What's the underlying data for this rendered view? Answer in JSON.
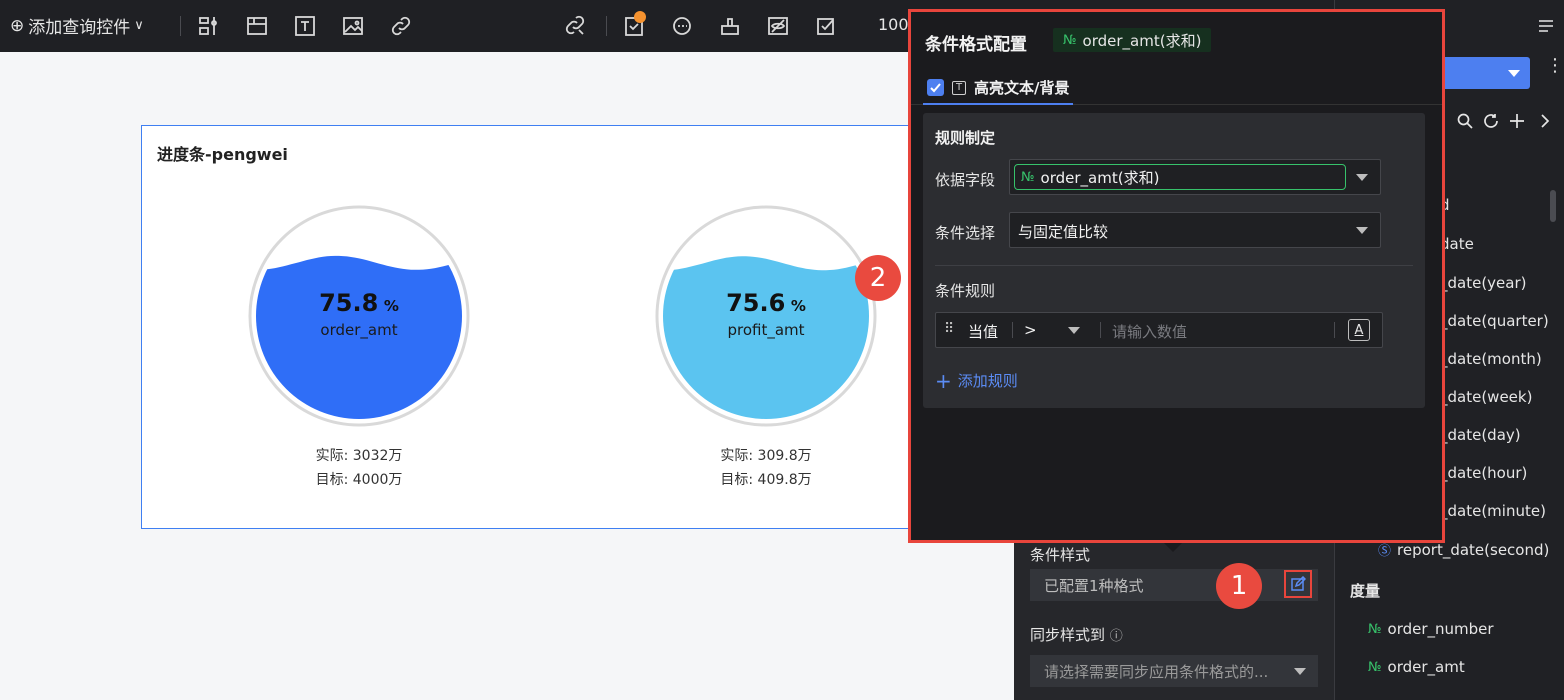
{
  "toolbar": {
    "add_query_label": "添加查询控件",
    "zoom": "100"
  },
  "card": {
    "title": "进度条-pengwei",
    "gauges": [
      {
        "value": "75.8",
        "unit": "%",
        "name": "order_amt",
        "actual": "实际: 3032万",
        "target": "目标: 4000万",
        "fill_fraction": 0.758,
        "color": "#2f6ef7"
      },
      {
        "value": "75.6",
        "unit": "%",
        "name": "profit_amt",
        "actual": "实际: 309.8万",
        "target": "目标: 409.8万",
        "fill_fraction": 0.756,
        "color": "#5bc4f0"
      }
    ]
  },
  "side": {
    "cond_style_label": "条件样式",
    "configured_text": "已配置1种格式",
    "sync_label": "同步样式到",
    "sync_placeholder": "请选择需要同步应用条件格式的..."
  },
  "markers": {
    "one": "1",
    "two": "2"
  },
  "popover": {
    "title": "条件格式配置",
    "field_tag": "order_amt(求和)",
    "field_tag_icon": "№",
    "tab_label": "高亮文本/背景",
    "tab_icon": "T",
    "rule_head": "规则制定",
    "basis_label": "依据字段",
    "basis_value": "order_amt(求和)",
    "cond_label": "条件选择",
    "cond_value": "与固定值比较",
    "rules_label": "条件规则",
    "rule": {
      "handle": "⠿",
      "subject": "当值",
      "operator": ">",
      "placeholder": "请输入数值",
      "style_icon": "A"
    },
    "add_rule": "添加规则"
  },
  "fields": {
    "dims": [
      "d",
      "date",
      "_date(year)",
      "_date(quarter)",
      "_date(month)",
      "_date(week)",
      "_date(day)",
      "_date(hour)",
      "_date(minute)"
    ],
    "last_dim": "report_date(second)",
    "measure_title": "度量",
    "measure_icon": "№",
    "measures": [
      "order_number",
      "order_amt"
    ]
  }
}
